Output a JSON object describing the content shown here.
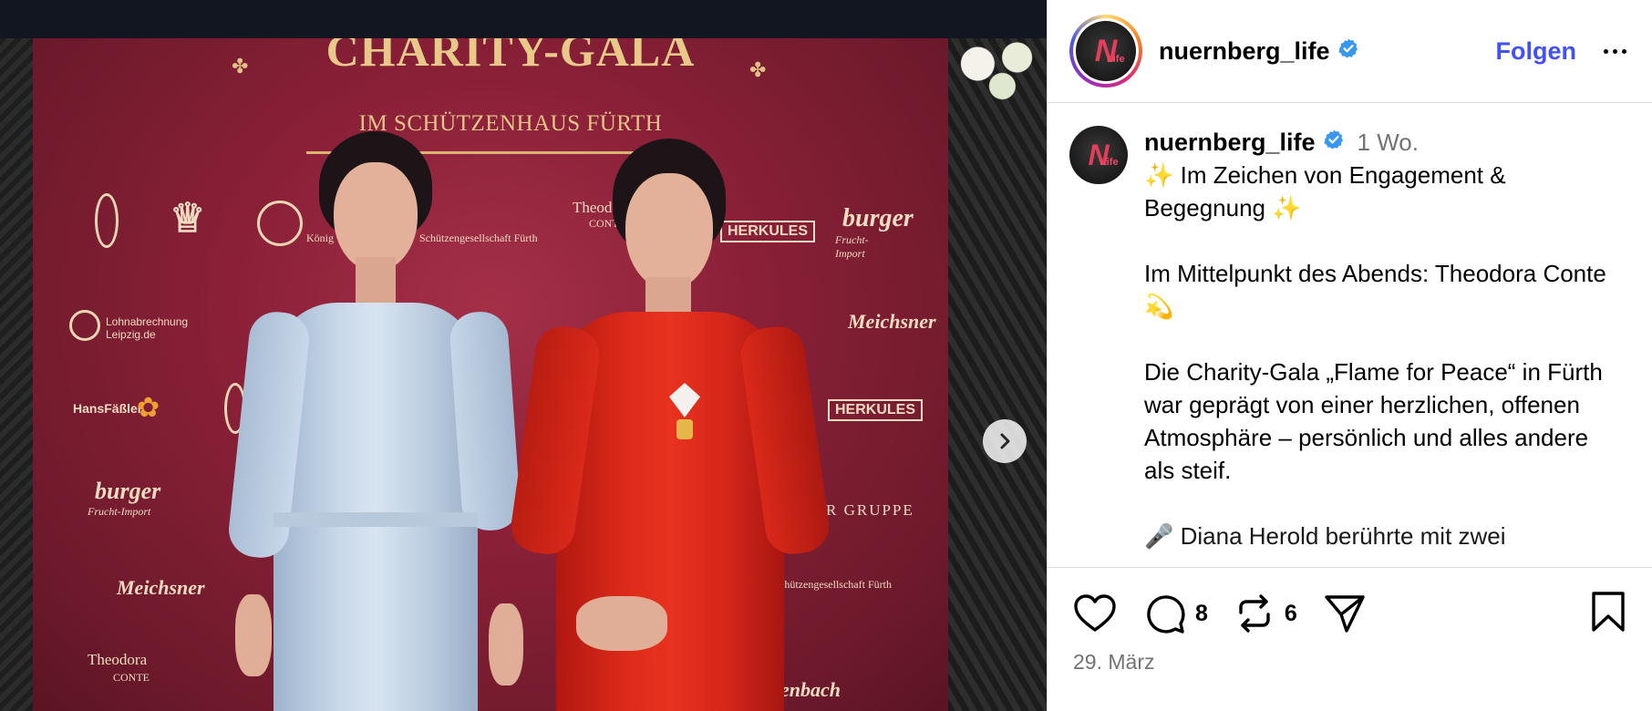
{
  "photo": {
    "gala_title": "CHARITY-GALA",
    "gala_subtitle": "IM SCHÜTZENHAUS FÜRTH",
    "sponsors": {
      "lohn": "Lohnabrechnung Leipzig.de",
      "hansfassler": "HansFäßler",
      "burger_left": "burger",
      "burger_left_sub": "Frucht-Import",
      "meichsner_left": "Meichsner",
      "theodora_left": "Theodora",
      "theodora_left_sub": "CONTE",
      "koenig": "König",
      "schuetzen": "Schützengesellschaft Fürth",
      "theodora_top": "Theodora",
      "theodora_top_sub": "CONTE",
      "herkules_top": "HERKULES",
      "burger_right": "burger",
      "burger_right_sub": "Frucht-Import",
      "meichsner_right": "Meichsner",
      "herkules_right": "HERKULES",
      "gruppe": "RGER GRUPPE",
      "schuetzen_right": "e Schützengesellschaft Fürth",
      "rosenbach": "enbach"
    }
  },
  "account": {
    "username": "nuernberg_life",
    "avatar_text": "N",
    "avatar_small_text": "Life",
    "follow_label": "Folgen"
  },
  "post": {
    "username": "nuernberg_life",
    "time_ago": "1 Wo.",
    "caption_lines": [
      "✨ Im Zeichen von Engagement & Begegnung ✨",
      "",
      "Im Mittelpunkt des Abends: Theodora Conte 💫",
      "",
      "Die Charity-Gala „Flame for Peace“ in Fürth war geprägt von einer herzlichen, offenen Atmosphäre – persönlich und alles andere als steif.",
      "",
      "🎤 Diana Herold berührte mit zwei"
    ],
    "comment_count": "8",
    "repost_count": "6",
    "date": "29. März"
  },
  "colors": {
    "accent": "#4150f7",
    "muted": "#737373",
    "verified": "#3897f0"
  }
}
